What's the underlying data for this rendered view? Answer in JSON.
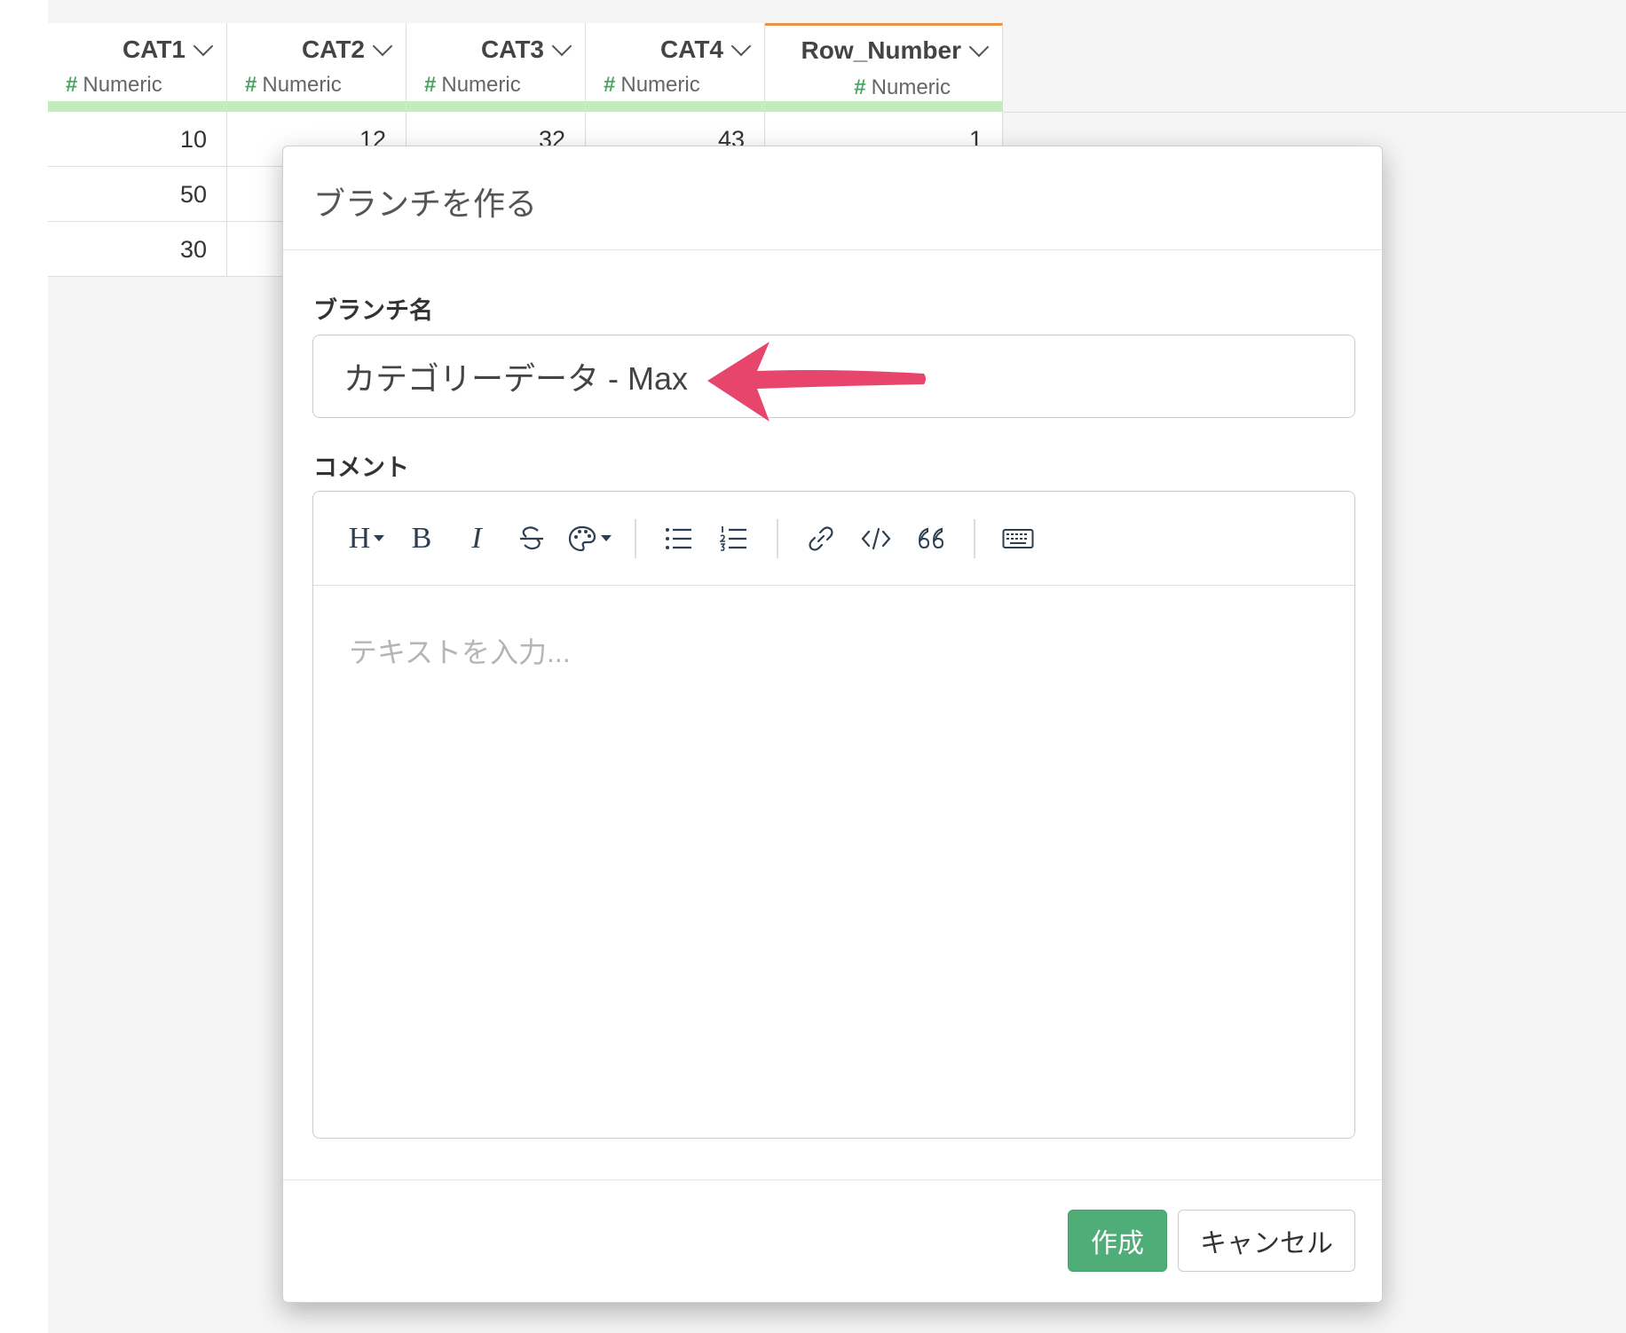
{
  "grid": {
    "columns": [
      {
        "name": "CAT1",
        "type": "Numeric",
        "selected": false
      },
      {
        "name": "CAT2",
        "type": "Numeric",
        "selected": false
      },
      {
        "name": "CAT3",
        "type": "Numeric",
        "selected": false
      },
      {
        "name": "CAT4",
        "type": "Numeric",
        "selected": false
      },
      {
        "name": "Row_Number",
        "type": "Numeric",
        "selected": true
      }
    ],
    "type_symbol": "#",
    "rows": [
      [
        "10",
        "12",
        "32",
        "43",
        "1"
      ],
      [
        "50",
        "",
        "",
        "",
        ""
      ],
      [
        "30",
        "",
        "",
        "",
        ""
      ]
    ],
    "type_bar_color": "#c3ecbd",
    "selected_border_color": "#e8954a"
  },
  "modal": {
    "title": "ブランチを作る",
    "branch_name_label": "ブランチ名",
    "branch_name_value": "カテゴリーデータ - Max",
    "comment_label": "コメント",
    "comment_placeholder": "テキストを入力...",
    "toolbar": {
      "heading_label": "H",
      "bold_label": "B",
      "italic_label": "I",
      "icons": [
        "heading-icon",
        "bold-icon",
        "italic-icon",
        "strikethrough-icon",
        "palette-icon",
        "bullet-list-icon",
        "numbered-list-icon",
        "link-icon",
        "code-icon",
        "quote-icon",
        "keyboard-icon"
      ]
    },
    "create_button": "作成",
    "cancel_button": "キャンセル",
    "primary_color": "#4fad78",
    "annotation_arrow_color": "#e8456d"
  }
}
